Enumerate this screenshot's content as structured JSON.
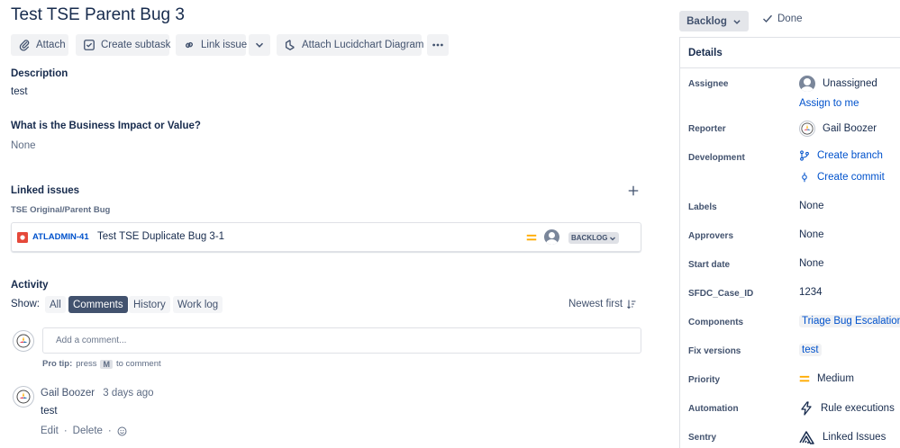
{
  "issue": {
    "title": "Test TSE Parent Bug 3"
  },
  "toolbar": {
    "attach": "Attach",
    "create_subtask": "Create subtask",
    "link_issue": "Link issue",
    "attach_lucidchart": "Attach Lucidchart Diagram"
  },
  "status": {
    "current": "Backlog",
    "done": "Done"
  },
  "description": {
    "label": "Description",
    "value": "test"
  },
  "business_impact": {
    "label": "What is the Business Impact or Value?",
    "value": "None"
  },
  "linked_issues": {
    "label": "Linked issues",
    "group_label": "TSE Original/Parent Bug",
    "items": [
      {
        "key": "ATLADMIN-41",
        "summary": "Test TSE Duplicate Bug 3-1",
        "status": "BACKLOG",
        "priority_color": "#ffab00"
      }
    ]
  },
  "activity": {
    "label": "Activity",
    "show_label": "Show:",
    "tabs": [
      "All",
      "Comments",
      "History",
      "Work log"
    ],
    "active_tab": "Comments",
    "sort": "Newest first",
    "comment_placeholder": "Add a comment...",
    "protip": {
      "prefix": "Pro tip:",
      "middle": "press",
      "key": "M",
      "suffix": "to comment"
    },
    "comments": [
      {
        "author": "Gail Boozer",
        "time": "3 days ago",
        "body": "test",
        "edit": "Edit",
        "delete": "Delete"
      }
    ]
  },
  "details": {
    "header": "Details",
    "assignee": {
      "label": "Assignee",
      "value": "Unassigned",
      "assign_link": "Assign to me"
    },
    "reporter": {
      "label": "Reporter",
      "value": "Gail Boozer"
    },
    "development": {
      "label": "Development",
      "create_branch": "Create branch",
      "create_commit": "Create commit"
    },
    "labels": {
      "label": "Labels",
      "value": "None"
    },
    "approvers": {
      "label": "Approvers",
      "value": "None"
    },
    "start_date": {
      "label": "Start date",
      "value": "None"
    },
    "sfdc_case_id": {
      "label": "SFDC_Case_ID",
      "value": "1234"
    },
    "components": {
      "label": "Components",
      "value": "Triage Bug Escalations"
    },
    "fix_versions": {
      "label": "Fix versions",
      "value": "test"
    },
    "priority": {
      "label": "Priority",
      "value": "Medium"
    },
    "automation": {
      "label": "Automation",
      "value": "Rule executions"
    },
    "sentry": {
      "label": "Sentry",
      "value": "Linked Issues"
    }
  },
  "colors": {
    "link": "#0052cc",
    "text": "#172b4d",
    "active_tab": "#42526e",
    "bug": "#e5493a",
    "priority_medium": "#ffab00"
  }
}
